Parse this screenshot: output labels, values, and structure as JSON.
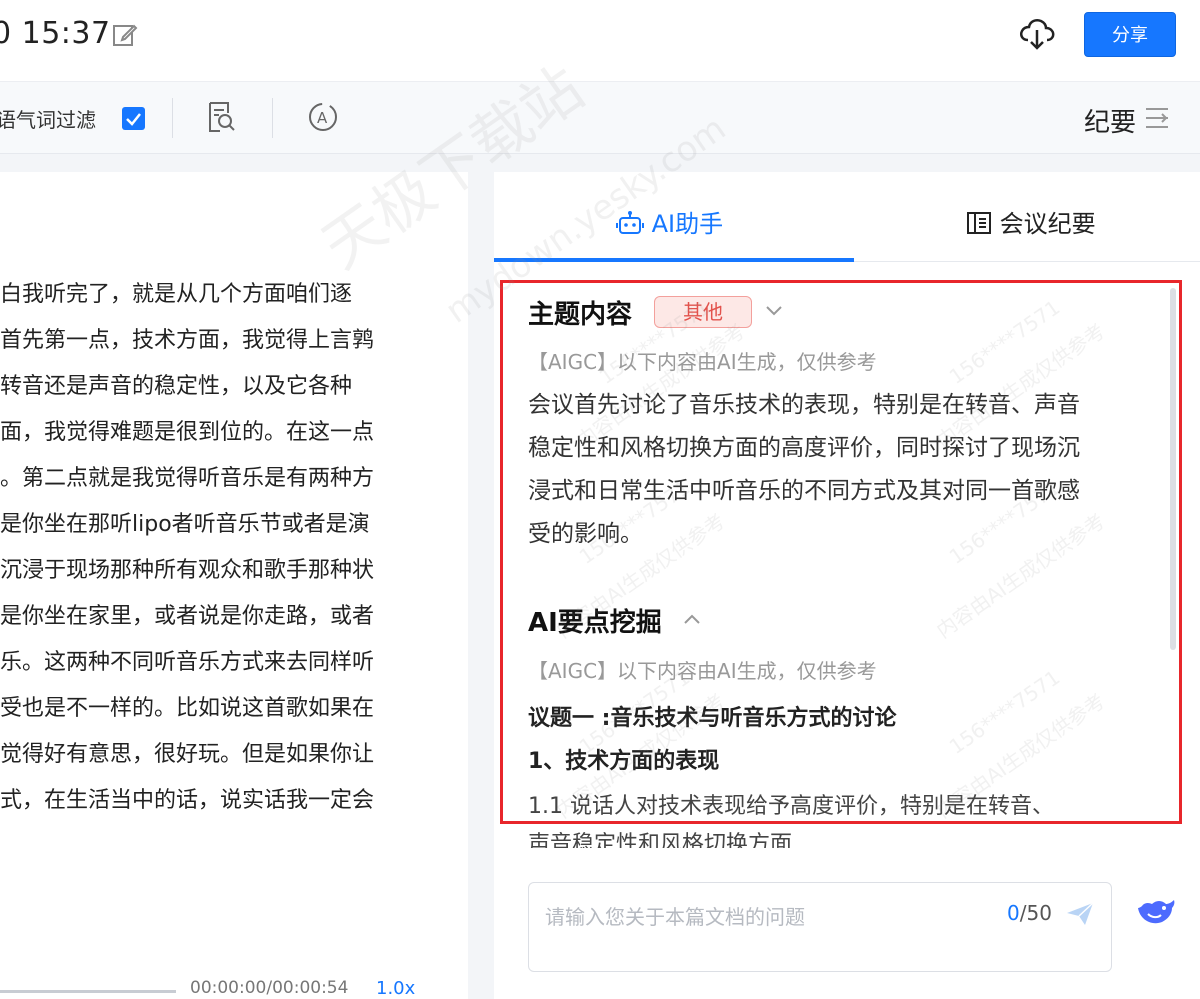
{
  "header": {
    "time_text": "0 15:37",
    "share_label": "分享"
  },
  "toolbar": {
    "filter_label": "语气词过滤",
    "filter_checked": true,
    "minutes_label": "纪要"
  },
  "transcript": {
    "lines": [
      "白我听完了，就是从几个方面咱们逐",
      "首先第一点，技术方面，我觉得上言鹑",
      "转音还是声音的稳定性，以及它各种",
      "面，我觉得难题是很到位的。在这一点",
      "。第二点就是我觉得听音乐是有两种方",
      "是你坐在那听lipo者听音乐节或者是演",
      "沉浸于现场那种所有观众和歌手那种状",
      "是你坐在家里，或者说是你走路，或者",
      "乐。这两种不同听音乐方式来去同样听",
      "受也是不一样的。比如说这首歌如果在",
      "觉得好有意思，很好玩。但是如果你让",
      "式，在生活当中的话，说实话我一定会"
    ]
  },
  "player": {
    "time": "00:00:00/00:00:54",
    "speed": "1.0x"
  },
  "right_panel": {
    "tabs": [
      {
        "label": "AI助手",
        "active": true
      },
      {
        "label": "会议纪要",
        "active": false
      }
    ],
    "topic": {
      "title": "主题内容",
      "tag": "其他",
      "aigc_note": "【AIGC】以下内容由AI生成，仅供参考",
      "summary_lines": [
        "会议首先讨论了音乐技术的表现，特别是在转音、声音",
        "稳定性和风格切换方面的高度评价，同时探讨了现场沉",
        "浸式和日常生活中听音乐的不同方式及其对同一首歌感",
        "受的影响。"
      ]
    },
    "key_points": {
      "title": "AI要点挖掘",
      "aigc_note": "【AIGC】以下内容由AI生成，仅供参考",
      "agenda": "议题一 :音乐技术与听音乐方式的讨论",
      "subheading": "1、技术方面的表现",
      "point_line1": "1.1 说话人对技术表现给予高度评价，特别是在转音、",
      "point_line2": "声音稳定性和风格切换方面"
    },
    "input": {
      "placeholder": "请输入您关于本篇文档的问题",
      "count_current": "0",
      "count_max": "/50"
    }
  },
  "watermarks": {
    "site_cn": "天极下载站",
    "site_url": "mydown.yesky.com",
    "user": "156****7571",
    "ai_notice": "内容由AI生成仅供参考"
  },
  "colors": {
    "accent": "#1677ff",
    "highlight_border": "#e8262b",
    "tag_text": "#e2524c"
  }
}
